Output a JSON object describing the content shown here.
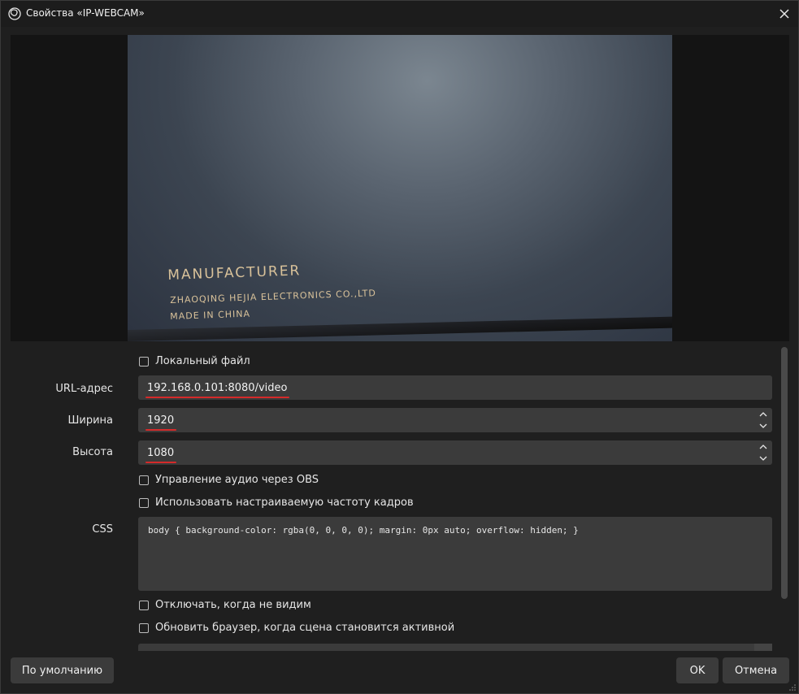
{
  "window": {
    "title": "Свойства «IP-WEBCAM»",
    "icon": "obs-logo-icon"
  },
  "preview": {
    "camera_text": {
      "title": "MANUFACTURER",
      "line1": "ZHAOQING HEJIA ELECTRONICS CO.,LTD",
      "line2": "MADE IN CHINA"
    }
  },
  "properties": {
    "local_file": {
      "label": "Локальный файл",
      "checked": false
    },
    "url": {
      "label": "URL-адрес",
      "value": "192.168.0.101:8080/video"
    },
    "width": {
      "label": "Ширина",
      "value": "1920"
    },
    "height": {
      "label": "Высота",
      "value": "1080"
    },
    "audio_control": {
      "label": "Управление аудио через OBS",
      "checked": false
    },
    "custom_fps": {
      "label": "Использовать настраиваемую частоту кадров",
      "checked": false
    },
    "css": {
      "label": "CSS",
      "value": "body { background-color: rgba(0, 0, 0, 0); margin: 0px auto; overflow: hidden; }"
    },
    "shutdown_hidden": {
      "label": "Отключать, когда не видим",
      "checked": false
    },
    "refresh_active": {
      "label": "Обновить браузер, когда сцена становится активной",
      "checked": false
    }
  },
  "buttons": {
    "defaults": "По умолчанию",
    "ok": "OK",
    "cancel": "Отмена"
  },
  "colors": {
    "background": "#1f1f1f",
    "field": "#3b3b3b",
    "underline": "#d42a2a"
  }
}
